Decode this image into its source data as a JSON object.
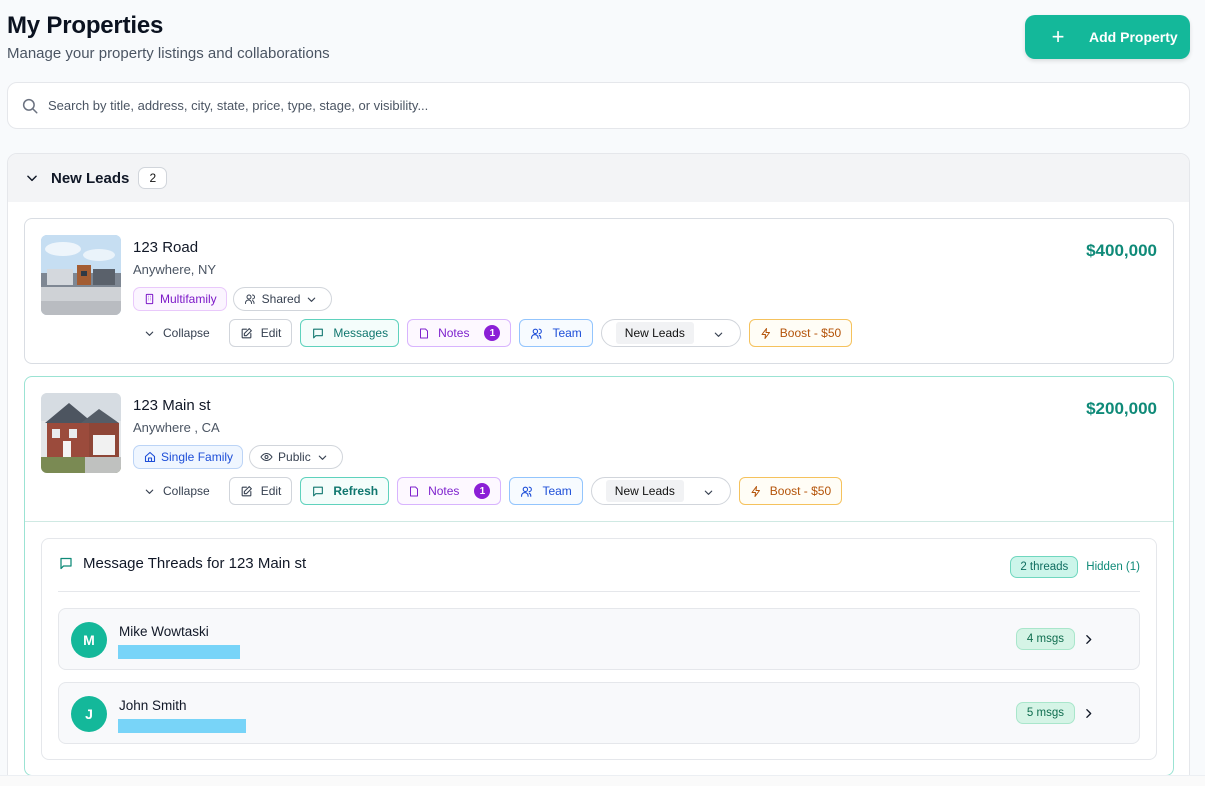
{
  "header": {
    "title": "My Properties",
    "subtitle": "Manage your property listings and collaborations",
    "add_button_label": "Add Property"
  },
  "search": {
    "placeholder": "Search by title, address, city, state, price, type, stage, or visibility..."
  },
  "stage_group": {
    "title": "New Leads",
    "count": "2"
  },
  "properties": [
    {
      "name": "123 Road",
      "location": "Anywhere, NY",
      "price": "$400,000",
      "type_tag": "Multifamily",
      "visibility": "Shared",
      "actions": {
        "collapse": "Collapse",
        "edit": "Edit",
        "messages": "Messages",
        "notes": "Notes",
        "notes_badge": "1",
        "team": "Team",
        "stage": "New Leads",
        "boost": "Boost - $50"
      }
    },
    {
      "name": "123 Main st",
      "location": "Anywhere , CA",
      "price": "$200,000",
      "type_tag": "Single Family",
      "visibility": "Public",
      "actions": {
        "collapse": "Collapse",
        "edit": "Edit",
        "messages": "Refresh",
        "notes": "Notes",
        "notes_badge": "1",
        "team": "Team",
        "stage": "New Leads",
        "boost": "Boost - $50"
      }
    }
  ],
  "threads_panel": {
    "title": "Message Threads for 123 Main st",
    "threads_count": "2 threads",
    "hidden_label": "Hidden (1)",
    "threads": [
      {
        "initial": "M",
        "name": "Mike Wowtaski",
        "msgs": "4 msgs"
      },
      {
        "initial": "J",
        "name": "John Smith",
        "msgs": "5 msgs"
      }
    ]
  },
  "colors": {
    "accent": "#14b89a",
    "price": "#0f8a78",
    "redaction": "#78d4f8"
  }
}
